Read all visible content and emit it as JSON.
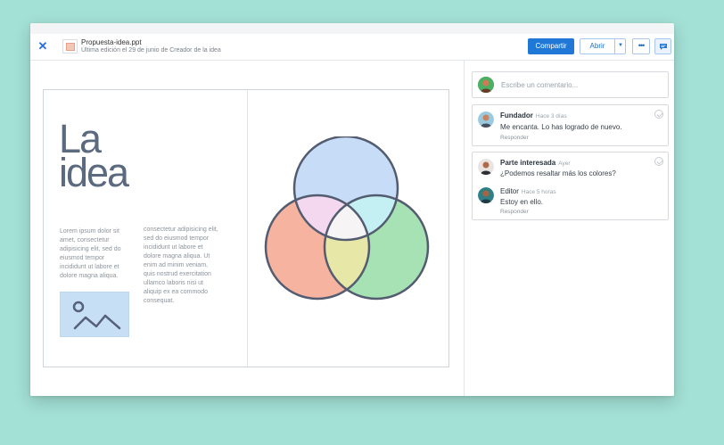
{
  "header": {
    "close_icon": "close-icon",
    "file_name": "Propuesta-idea.ppt",
    "file_subtitle": "Última edición el 29 de junio de Creador de la idea",
    "share_label": "Compartir",
    "open_label": "Abrir",
    "more_label": "•••",
    "colors": {
      "accent": "#1f77d6",
      "background": "#a3e0d5"
    }
  },
  "slide": {
    "title_line1": "La",
    "title_line2": "idea",
    "lorem_col1": "Lorem ipsum dolor sit amet, consectetur adipisicing elit, sed do eiusmod tempor incididunt ut labore et dolore magna aliqua.",
    "lorem_col2": "consectetur adipisicing elit, sed do eiusmod tempor incididunt ut labore et dolore magna aliqua. Ut enim ad minim veniam, quis nostrud exercitation ullamco laboris nisi ut aliquip ex ea commodo consequat.",
    "venn_colors": {
      "top": "#c7ddf7",
      "left": "#f6b39f",
      "right": "#a6e2b3",
      "outline": "#535c70"
    }
  },
  "comments": {
    "input_placeholder": "Escribe un comentario...",
    "threads": [
      {
        "author": "Fundador",
        "time": "Hace 3 días",
        "text": "Me encanta. Lo has logrado de nuevo.",
        "reply_label": "Responder"
      },
      {
        "author": "Parte interesada",
        "time": "Ayer",
        "text": "¿Podemos resaltar más los colores?",
        "reply": {
          "author": "Editor",
          "time": "Hace 5 horas",
          "text": "Estoy en ello."
        },
        "reply_label": "Responder"
      }
    ]
  }
}
